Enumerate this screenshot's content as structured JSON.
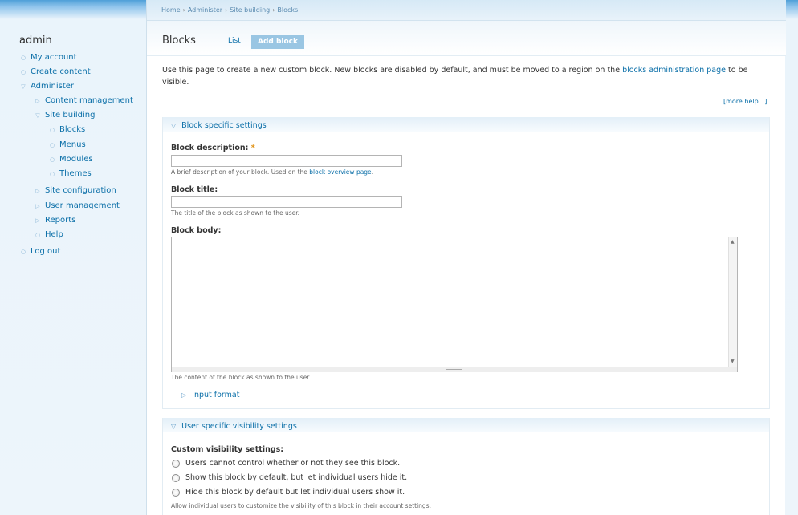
{
  "breadcrumb": [
    "Home",
    "Administer",
    "Site building",
    "Blocks"
  ],
  "sidebar": {
    "user": "admin",
    "items": [
      {
        "label": "My account",
        "bullet": "○"
      },
      {
        "label": "Create content",
        "bullet": "○"
      },
      {
        "label": "Administer",
        "bullet": "▽"
      },
      {
        "label": "Content management",
        "bullet": "▷"
      },
      {
        "label": "Site building",
        "bullet": "▽"
      },
      {
        "label": "Blocks",
        "bullet": "○"
      },
      {
        "label": "Menus",
        "bullet": "○"
      },
      {
        "label": "Modules",
        "bullet": "○"
      },
      {
        "label": "Themes",
        "bullet": "○"
      },
      {
        "label": "Site configuration",
        "bullet": "▷"
      },
      {
        "label": "User management",
        "bullet": "▷"
      },
      {
        "label": "Reports",
        "bullet": "▷"
      },
      {
        "label": "Help",
        "bullet": "○"
      },
      {
        "label": "Log out",
        "bullet": "○"
      }
    ]
  },
  "page": {
    "title": "Blocks",
    "tab_list": "List",
    "tab_add": "Add block",
    "intro_before": "Use this page to create a new custom block. New blocks are disabled by default, and must be moved to a region on the ",
    "intro_link": "blocks administration page",
    "intro_after": " to be visible.",
    "more_help": "[more help...]"
  },
  "block_settings": {
    "legend": "Block specific settings",
    "arrow": "▽",
    "description_label": "Block description:",
    "required_mark": "*",
    "description_help_before": "A brief description of your block. Used on the ",
    "description_help_link": "block overview page",
    "description_help_after": ".",
    "title_label": "Block title:",
    "title_help": "The title of the block as shown to the user.",
    "body_label": "Block body:",
    "body_help": "The content of the block as shown to the user.",
    "input_format": "Input format",
    "input_format_arrow": "▷"
  },
  "visibility": {
    "legend": "User specific visibility settings",
    "arrow": "▽",
    "custom_label": "Custom visibility settings:",
    "options": [
      "Users cannot control whether or not they see this block.",
      "Show this block by default, but let individual users hide it.",
      "Hide this block by default but let individual users show it."
    ],
    "help": "Allow individual users to customize the visibility of this block in their account settings."
  }
}
